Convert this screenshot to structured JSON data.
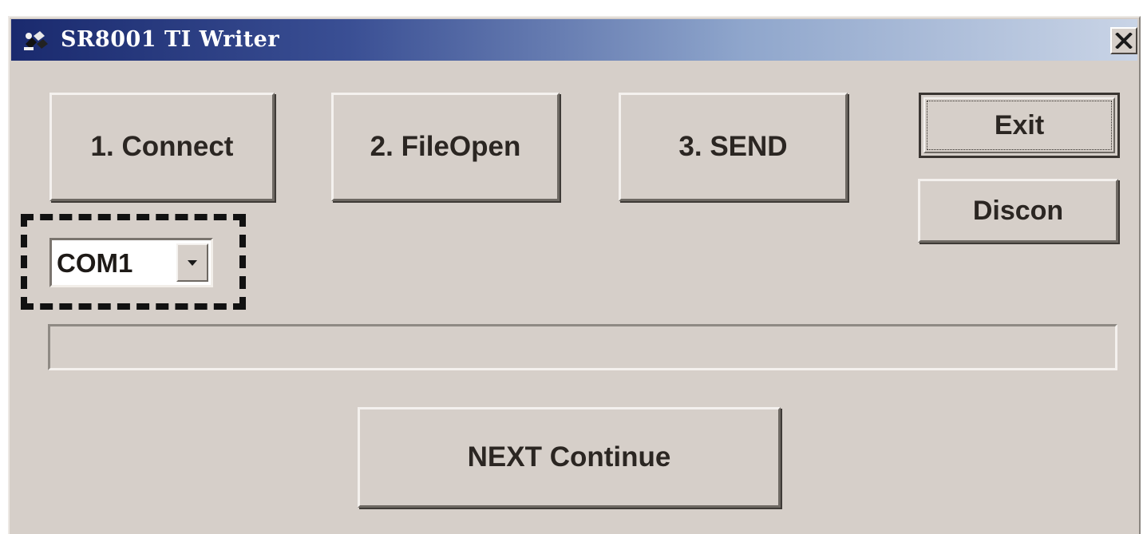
{
  "window": {
    "title": "SR8001 TI Writer",
    "close_label": "✕"
  },
  "buttons": {
    "connect": "1. Connect",
    "file_open": "2. FileOpen",
    "send": "3. SEND",
    "exit": "Exit",
    "discon": "Discon",
    "next_continue": "NEXT Continue"
  },
  "port_select": {
    "value": "COM1",
    "highlighted": true
  },
  "progress": {
    "fraction": 0
  },
  "colors": {
    "titlebar_start": "#1a2a6e",
    "titlebar_end": "#c9d4e6",
    "face": "#d6cfc9"
  },
  "icons": {
    "app": "app-icon",
    "close": "close-icon",
    "combo_arrow": "chevron-down-icon"
  }
}
